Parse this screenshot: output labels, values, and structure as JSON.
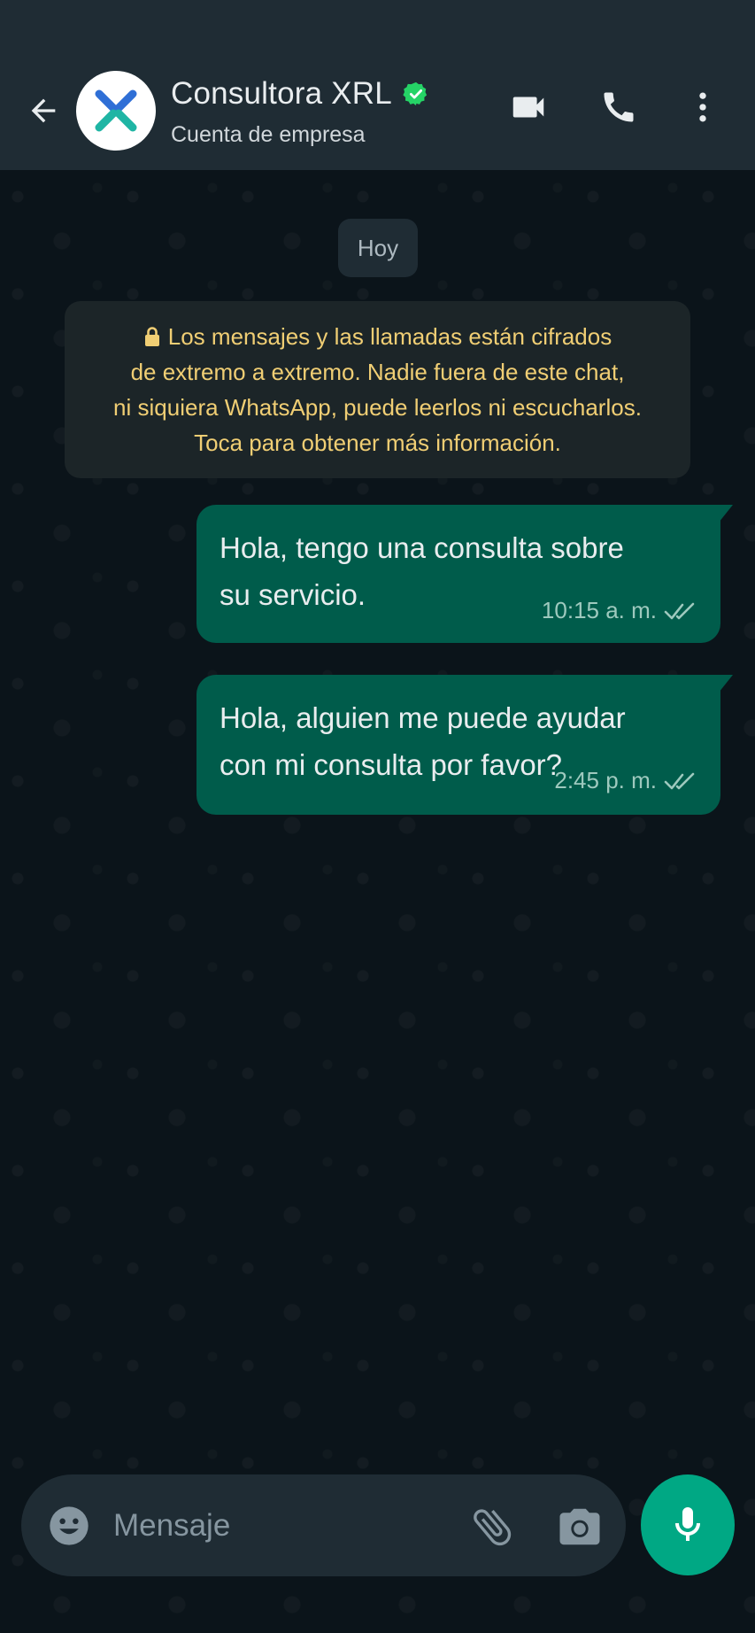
{
  "header": {
    "title": "Consultora XRL",
    "subtitle": "Cuenta de empresa",
    "icons": [
      "back-arrow-icon",
      "verified-badge-icon",
      "video-call-icon",
      "phone-icon",
      "more-vert-icon"
    ]
  },
  "chat": {
    "date_label": "Hoy",
    "encryption_notice": {
      "line1": "Los mensajes y las llamadas están cifrados",
      "line2": "de extremo a extremo. Nadie fuera de este chat,",
      "line3": "ni siquiera WhatsApp, puede leerlos ni escucharlos.",
      "line4": "Toca para obtener más información."
    },
    "messages": [
      {
        "line1": "Hola, tengo una consulta sobre",
        "line2": "su servicio.",
        "time": "10:15 a. m.",
        "status": "read"
      },
      {
        "line1": "Hola, alguien me puede ayudar",
        "line2": "con mi consulta por favor?",
        "time": "2:45 p. m.",
        "status": "read"
      }
    ]
  },
  "composer": {
    "placeholder": "Mensaje",
    "icons": [
      "emoji-icon",
      "attach-icon",
      "camera-icon",
      "mic-icon"
    ]
  },
  "colors": {
    "background": "#0b141a",
    "header": "#1f2c34",
    "outgoing_bubble": "#005c4b",
    "accent": "#00a884",
    "notice_text": "#f0ce74",
    "verified": "#25d366"
  }
}
